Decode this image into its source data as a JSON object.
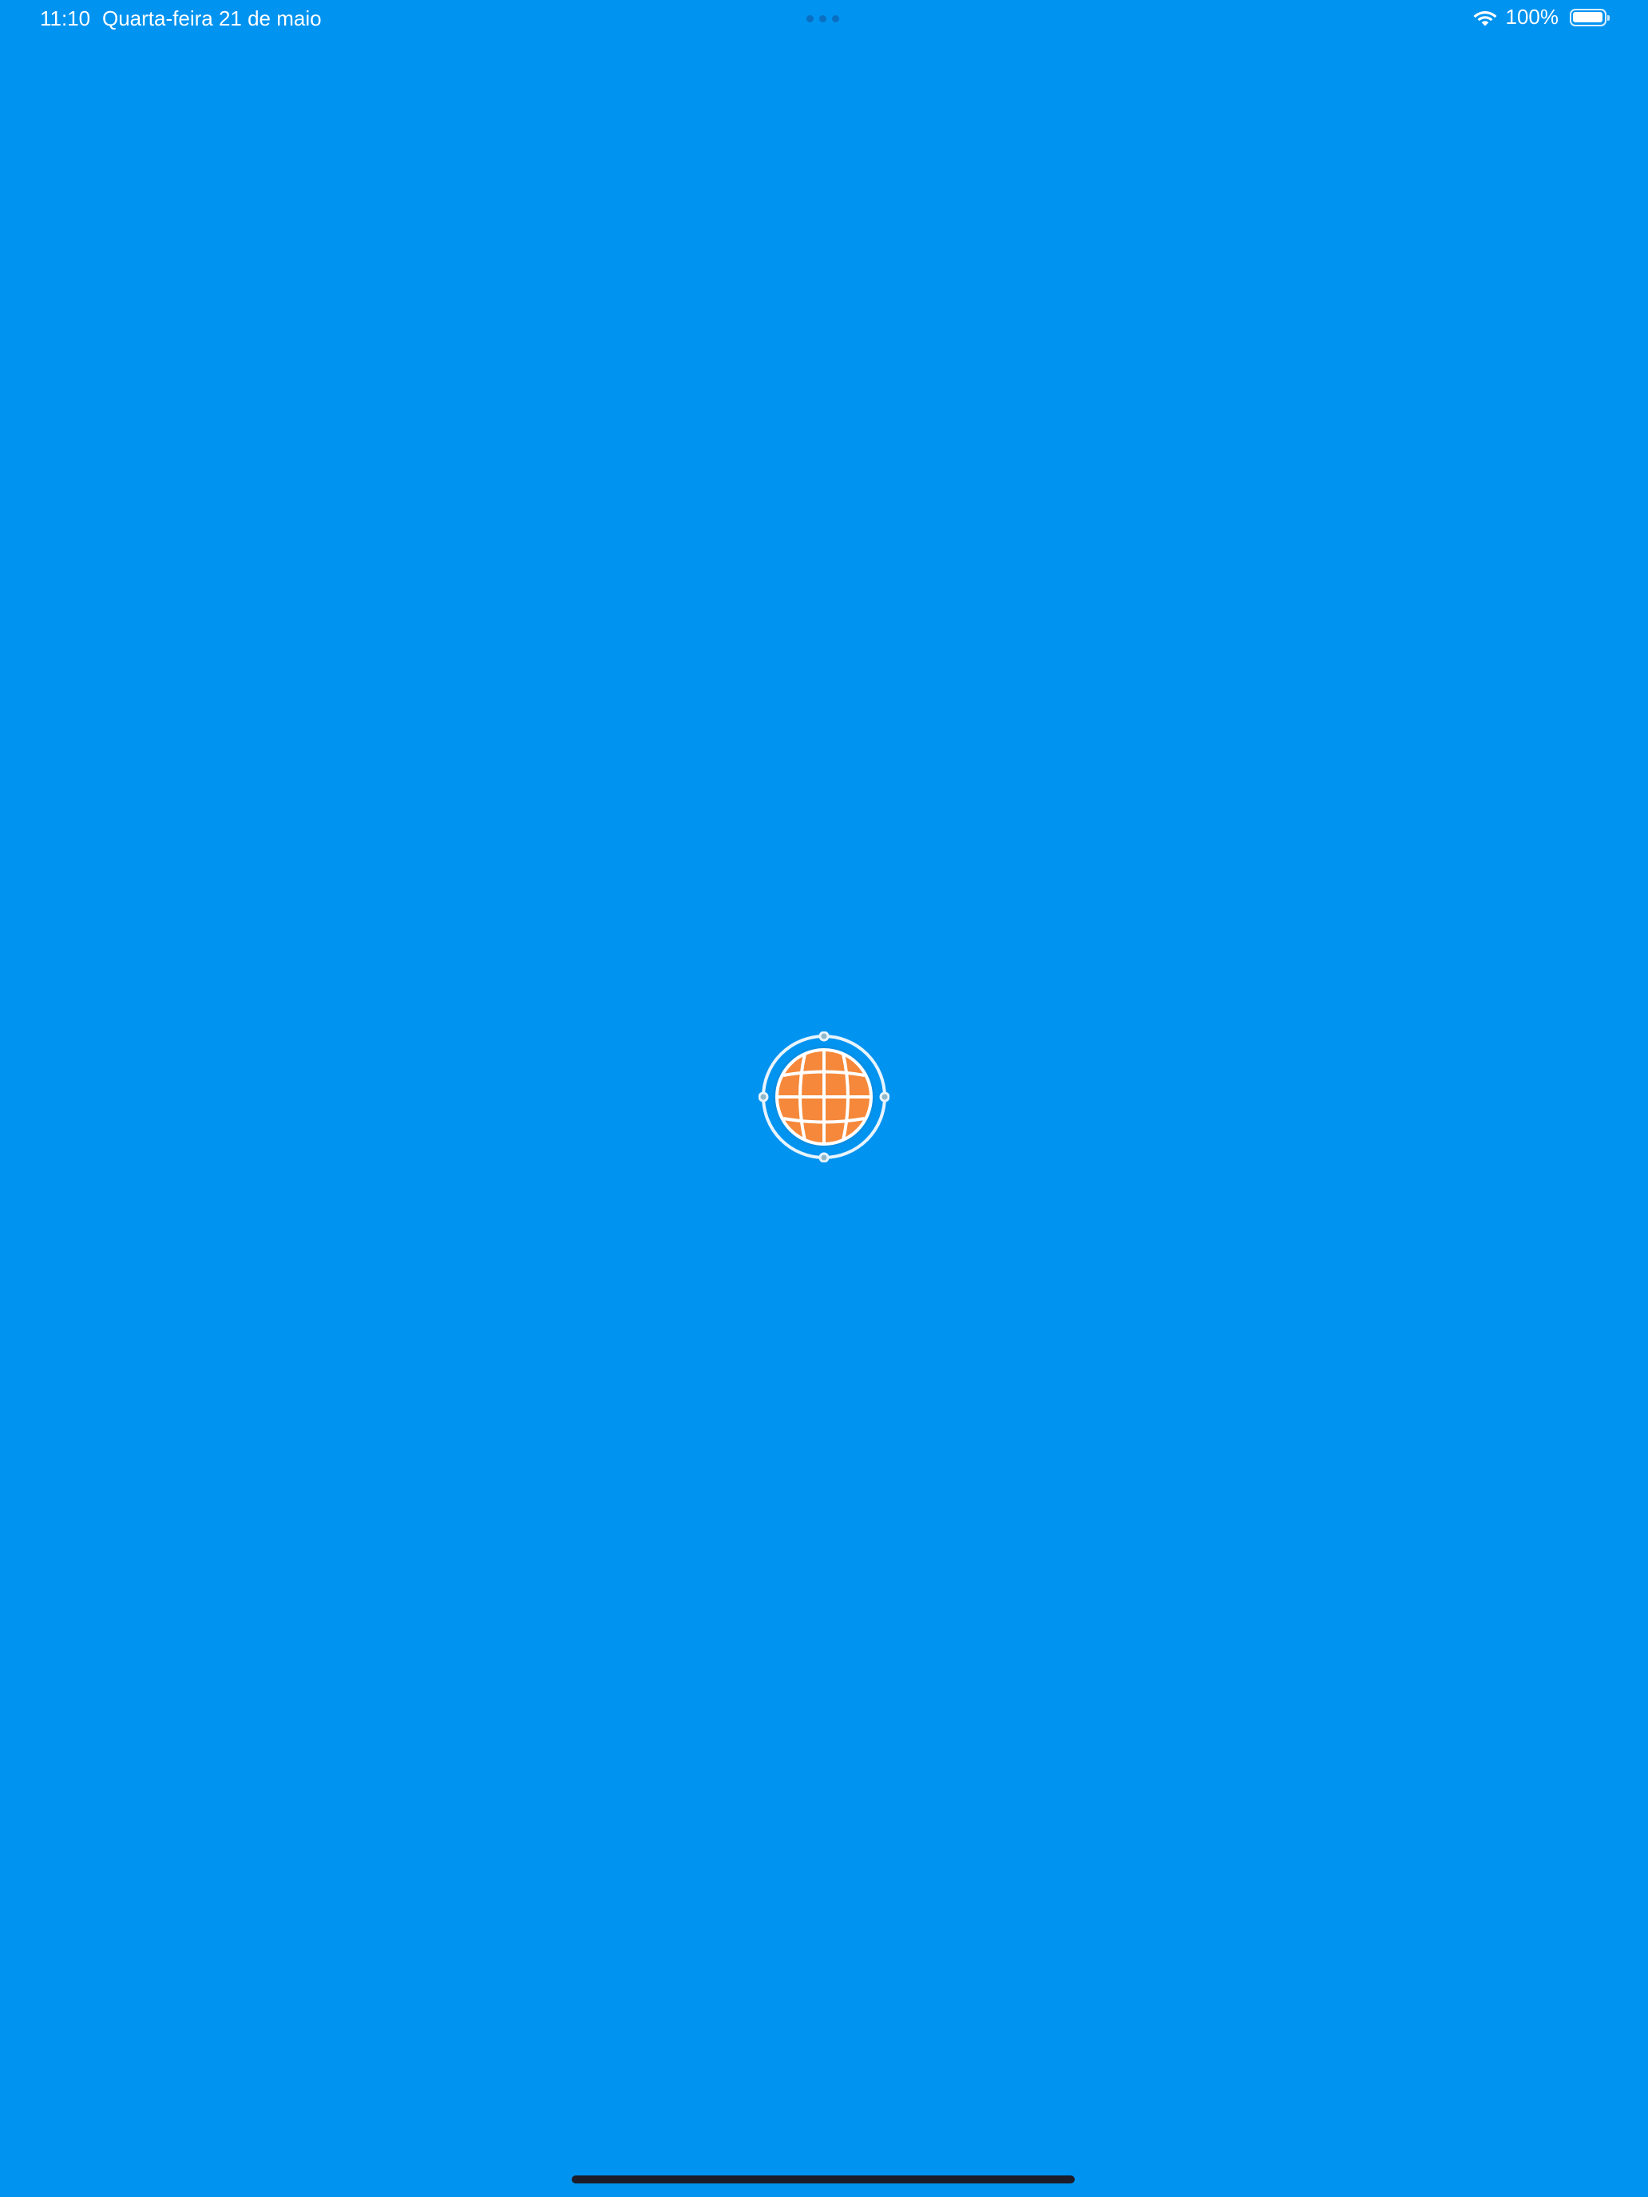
{
  "status_bar": {
    "time": "11:10",
    "date": "Quarta-feira 21 de maio",
    "battery_text": "100%",
    "battery_level": 1.0,
    "wifi_icon": "wifi-icon",
    "battery_icon": "battery-icon"
  },
  "splash": {
    "logo_icon": "globe-logo-icon",
    "colors": {
      "background": "#0093F0",
      "globe": "#F5883A",
      "ring": "#ffffff"
    }
  }
}
